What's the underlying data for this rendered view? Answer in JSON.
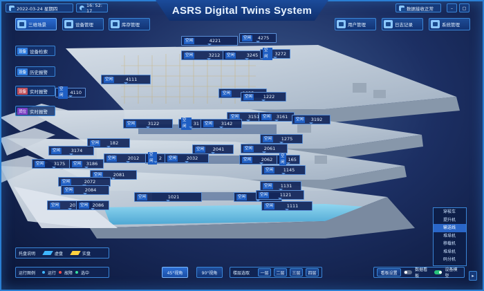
{
  "app": {
    "title": "ASRS Digital Twins System"
  },
  "header": {
    "date": "2022-03-24 星期四",
    "time": "16: 52: 17",
    "status": "数据接收正常",
    "nav_left": [
      {
        "label": "三维场景"
      },
      {
        "label": "设备管理"
      },
      {
        "label": "库存管理"
      }
    ],
    "nav_right": [
      {
        "label": "用户管理"
      },
      {
        "label": "日志记录"
      },
      {
        "label": "系统管理"
      }
    ]
  },
  "sidebar": [
    {
      "tag": "设备",
      "label": "设备检索"
    },
    {
      "tag": "设备",
      "label": "历史报警"
    },
    {
      "tag": "设备",
      "label": "实时报警"
    },
    {
      "tag": "货位",
      "label": "实时报警"
    }
  ],
  "slot_status": "空闲",
  "slots": [
    "4221",
    "4275",
    "3212",
    "3245",
    "3272",
    "4111",
    "4110",
    "1035",
    "1222",
    "3151",
    "3161",
    "3192",
    "3122",
    "31",
    "3142",
    "182",
    "1275",
    "3174",
    "2041",
    "2061",
    "2012",
    "2",
    "2032",
    "2062",
    "165",
    "3175",
    "3186",
    "2081",
    "1145",
    "2072",
    "2084",
    "1131",
    "1021",
    "1051",
    "1121",
    "2075",
    "2086",
    "1111"
  ],
  "legend": {
    "title": "托盘说明",
    "empty": "虚盘",
    "full": "实盘"
  },
  "run": {
    "title": "运行图例",
    "items": [
      {
        "label": "运行",
        "color": "#3fb7ff"
      },
      {
        "label": "故障",
        "color": "#ff4b4b"
      },
      {
        "label": "选中",
        "color": "#36e0a0"
      }
    ]
  },
  "views": [
    {
      "label": "45°视角"
    },
    {
      "label": "90°视角"
    }
  ],
  "floor_select": {
    "label": "楼层选取",
    "floors": [
      "一层",
      "二层",
      "三层",
      "四层"
    ]
  },
  "panel": {
    "label": "看板设置",
    "data_board": "数据看板",
    "device_board": "设备模型"
  },
  "device_menu": [
    "穿梭车",
    "提升机",
    "输送线",
    "堆垛机",
    "移载机",
    "堆垛机",
    "码分机"
  ],
  "device_menu_selected": 2
}
